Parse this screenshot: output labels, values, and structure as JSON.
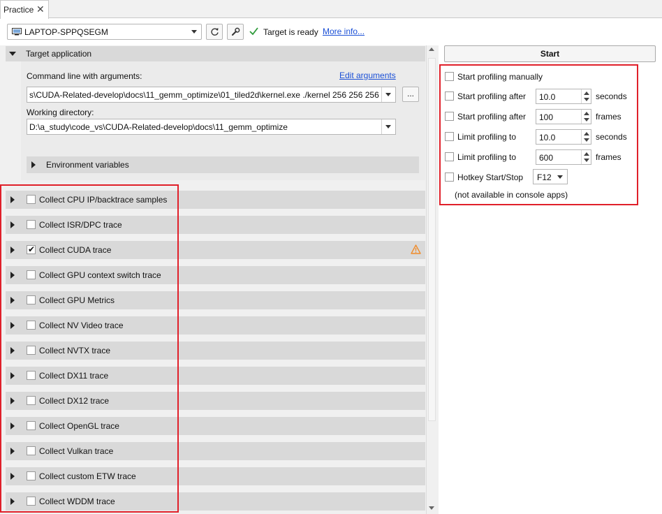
{
  "tab": {
    "label": "Practice",
    "close_glyph": "✕"
  },
  "toolbar": {
    "device": "LAPTOP-SPPQSEGM",
    "device_icon": "computer-icon",
    "refresh_icon": "refresh-icon",
    "settings_icon": "wrench-icon",
    "status_icon": "checkmark-icon",
    "status": "Target is ready",
    "more_info": "More info..."
  },
  "target_app": {
    "title": "Target application",
    "command_label": "Command line with arguments:",
    "edit_arguments": "Edit arguments",
    "command_value": "s\\CUDA-Related-develop\\docs\\11_gemm_optimize\\01_tiled2d\\kernel.exe ./kernel 256 256 256",
    "browse_label": "...",
    "workdir_label": "Working directory:",
    "workdir_value": "D:\\a_study\\code_vs\\CUDA-Related-develop\\docs\\11_gemm_optimize",
    "env_label": "Environment variables"
  },
  "traces": [
    {
      "label": "Collect CPU IP/backtrace samples",
      "checked": false
    },
    {
      "label": "Collect ISR/DPC trace",
      "checked": false
    },
    {
      "label": "Collect CUDA trace",
      "checked": true,
      "warning": true
    },
    {
      "label": "Collect GPU context switch trace",
      "checked": false
    },
    {
      "label": "Collect GPU Metrics",
      "checked": false
    },
    {
      "label": "Collect NV Video trace",
      "checked": false
    },
    {
      "label": "Collect NVTX trace",
      "checked": false
    },
    {
      "label": "Collect DX11 trace",
      "checked": false
    },
    {
      "label": "Collect DX12 trace",
      "checked": false
    },
    {
      "label": "Collect OpenGL trace",
      "checked": false
    },
    {
      "label": "Collect Vulkan trace",
      "checked": false
    },
    {
      "label": "Collect custom ETW trace",
      "checked": false
    },
    {
      "label": "Collect WDDM trace",
      "checked": false
    }
  ],
  "profiling": {
    "start_button": "Start",
    "manual": "Start profiling manually",
    "start_after_seconds": {
      "label": "Start profiling after",
      "value": "10.0",
      "unit": "seconds"
    },
    "start_after_frames": {
      "label": "Start profiling after",
      "value": "100",
      "unit": "frames"
    },
    "limit_seconds": {
      "label": "Limit profiling to",
      "value": "10.0",
      "unit": "seconds"
    },
    "limit_frames": {
      "label": "Limit profiling to",
      "value": "600",
      "unit": "frames"
    },
    "hotkey": {
      "label": "Hotkey Start/Stop",
      "value": "F12"
    },
    "note": "(not available in console apps)"
  },
  "colors": {
    "highlight": "#e0202a",
    "link": "#1a4fd6",
    "warning": "#f08c2a",
    "ready_check": "#2e9a3a"
  }
}
